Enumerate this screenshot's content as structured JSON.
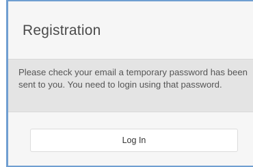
{
  "dialog": {
    "title": "Registration",
    "message": "Please check your email a temporary password has been sent to you. You need to login using that password.",
    "login_button_label": "Log In"
  },
  "colors": {
    "accent_border": "#6f9ed1",
    "message_bar_bg": "#e4e4e4",
    "dialog_bg": "#f6f6f6"
  }
}
